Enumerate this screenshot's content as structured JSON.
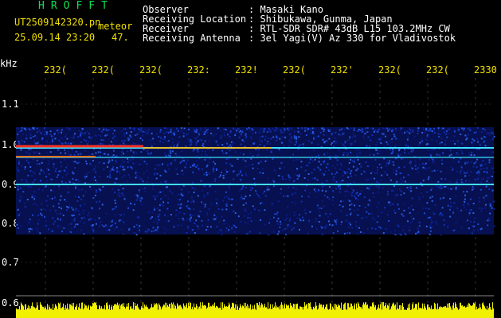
{
  "header": {
    "app_title": "HROFFT",
    "filename": "UT2509142320.pn",
    "type": "meteor",
    "datetime": "25.09.14 23:20",
    "count": "47.",
    "info": [
      {
        "label": "Observer",
        "value": ": Masaki Kano"
      },
      {
        "label": "Receiving Location",
        "value": ": Shibukawa, Gunma, Japan"
      },
      {
        "label": "Receiver",
        "value": ": RTL-SDR SDR# 43dB L15 103.2MHz CW"
      },
      {
        "label": "Receiving Antenna",
        "value": ": 3el Yagi(V) Az 330 for Vladivostok"
      }
    ]
  },
  "axis": {
    "unit": "kHz",
    "time_ticks": [
      "232(",
      "232(",
      "232(",
      "232:",
      "232!",
      "232(",
      "232'",
      "232(",
      "232(",
      "2330"
    ],
    "freq_ticks": [
      "1.1",
      "1.0",
      "0.9",
      "0.8",
      "0.7",
      "0.6"
    ]
  },
  "colors": {
    "background": "#000000",
    "text": "#ffffff",
    "title": "#10e050",
    "tick_label": "#f0e000",
    "signal_low": "#1030c0",
    "signal_high": "#ff3020",
    "carrier": "#40e0ff",
    "noise_bar": "#f0f000"
  }
}
